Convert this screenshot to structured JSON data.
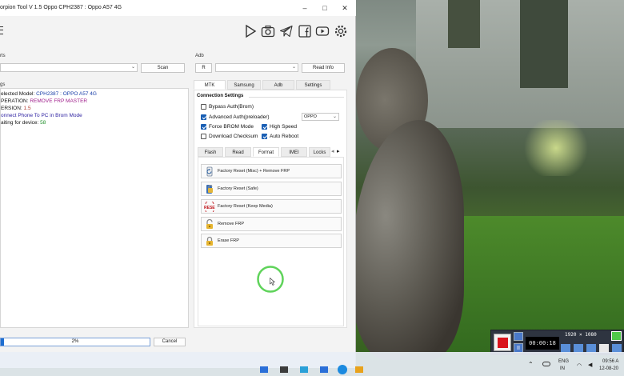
{
  "window": {
    "title": "orpion Tool V 1.5 Oppo CPH2387 : Oppo A57 4G",
    "controls": [
      "–",
      "□",
      "✕"
    ]
  },
  "toolbar": {
    "icons": [
      "play-icon",
      "camera-icon",
      "telegram-icon",
      "facebook-icon",
      "youtube-icon",
      "settings-gear-icon"
    ]
  },
  "ports": {
    "label": "rts",
    "scan_label": "Scan"
  },
  "adb": {
    "label": "Adb",
    "r_label": "R",
    "read_info_label": "Read Info"
  },
  "logs": {
    "label": "gs",
    "lines": [
      {
        "prefix": "elected Model: ",
        "value": "CPH2387 : OPPO A57 4G",
        "color": "#1a3fa8"
      },
      {
        "prefix": "PERATION: ",
        "value": "REMOVE FRP MASTER",
        "color": "#a0208c"
      },
      {
        "prefix": "ERSION: ",
        "value": "1.5",
        "color": "#b03a2e"
      },
      {
        "prefix": "",
        "value": "onnect Phone To PC in Brom Mode",
        "color": "#2b1fa0"
      },
      {
        "prefix": "aiting for device: ",
        "value": "58",
        "color": "#1f8f2a"
      }
    ]
  },
  "main_tabs": [
    "MTK",
    "Samsung",
    "Adb",
    "Settings"
  ],
  "connection": {
    "heading": "Connection Settings",
    "bypass_auth": {
      "label": "Bypass Auth(Brom)",
      "checked": false
    },
    "advanced_auth": {
      "label": "Advanced Auth(preloader)",
      "checked": true
    },
    "brand_value": "OPPO",
    "force_brom": {
      "label": "Force BROM Mode",
      "checked": true
    },
    "high_speed": {
      "label": "High Speed",
      "checked": true
    },
    "download_checksum": {
      "label": "Download Checksum",
      "checked": false
    },
    "auto_reboot": {
      "label": "Auto Reboot",
      "checked": true
    }
  },
  "sub_tabs": [
    "Flash",
    "Read",
    "Format",
    "IMEI",
    "Locks"
  ],
  "actions": [
    {
      "label": "Factory Reset (Misc) + Remove FRP",
      "icon": "refresh-phone-icon"
    },
    {
      "label": "Factory Reset (Safe)",
      "icon": "unlock-phone-icon"
    },
    {
      "label": "Factory Reset (Keep Media)",
      "icon": "reset-icon"
    },
    {
      "label": "Remove FRP",
      "icon": "padlock-open-icon"
    },
    {
      "label": "Erase FRP",
      "icon": "padlock-icon"
    }
  ],
  "progress": {
    "text": "2%",
    "value": 0.02
  },
  "cancel_label": "Cancel",
  "recorder": {
    "timer": "00:00:18",
    "resolution": "1920 × 1080"
  },
  "tray": {
    "lang_top": "ENG",
    "lang_bottom": "IN",
    "time": "09:56 A",
    "date": "12-08-20"
  },
  "colors": {
    "accent": "#1a5fb4",
    "progress": "#1f6fd1",
    "record": "#d9141c",
    "cursor_ring": "#5fd35a"
  }
}
